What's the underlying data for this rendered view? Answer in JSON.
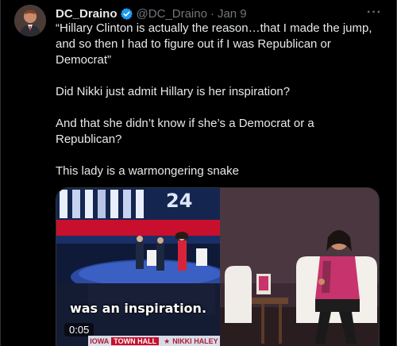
{
  "tweet": {
    "display_name": "DC_Draino",
    "handle": "@DC_Draino",
    "separator": "·",
    "timestamp": "Jan 9",
    "more_label": "···",
    "paragraphs": [
      "“Hillary Clinton is actually the reason…that I made the jump, and so then I had to figure out if I was Republican or Democrat”",
      "Did Nikki just admit Hillary is her inspiration?",
      "And that she didn’t know if she’s a Democrat or a Republican?",
      "This lady is a warmongering snake"
    ]
  },
  "video": {
    "caption": "was an inspiration.",
    "duration": "0:05",
    "ticker_left": "IOWA",
    "ticker_highlight": "TOWN HALL",
    "ticker_star": "★",
    "ticker_right": "NIKKI HALEY",
    "stage_badge": "24"
  },
  "colors": {
    "background": "#000000",
    "text": "#e7e9ea",
    "secondary_text": "#71767b",
    "verified_blue": "#1d9bf0",
    "ticker_red": "#c8102e"
  },
  "icons": {
    "verified": "verified-badge-icon",
    "more": "more-dots-icon"
  }
}
